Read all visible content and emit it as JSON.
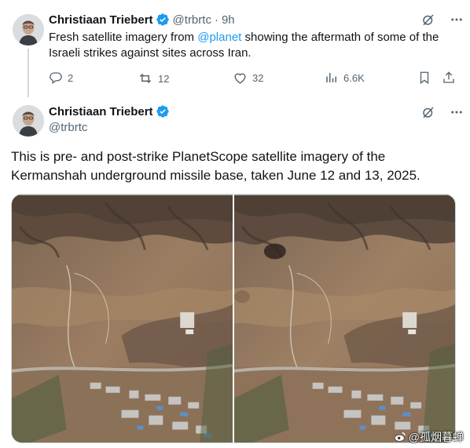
{
  "tweet1": {
    "display_name": "Christiaan Triebert",
    "handle": "@trbrtc",
    "separator": "·",
    "time": "9h",
    "text_before": "Fresh satellite imagery from ",
    "mention": "@planet",
    "text_after": " showing the aftermath of some of the Israeli strikes against sites across Iran.",
    "stats": {
      "replies": "2",
      "reposts": "12",
      "likes": "32",
      "views": "6.6K"
    }
  },
  "tweet2": {
    "display_name": "Christiaan Triebert",
    "handle": "@trbrtc",
    "text": "This is pre- and post-strike PlanetScope satellite imagery of the Kermanshah underground missile base, taken June 12 and 13, 2025."
  },
  "watermark": "@孤烟暮蝉",
  "colors": {
    "accent": "#1d9bf0",
    "secondary_text": "#536471",
    "verified": "#1d9bf0"
  },
  "icons": [
    "grok-icon",
    "more-icon",
    "reply-icon",
    "repost-icon",
    "like-icon",
    "views-icon",
    "bookmark-icon",
    "share-icon",
    "verified-badge-icon",
    "weibo-icon"
  ]
}
